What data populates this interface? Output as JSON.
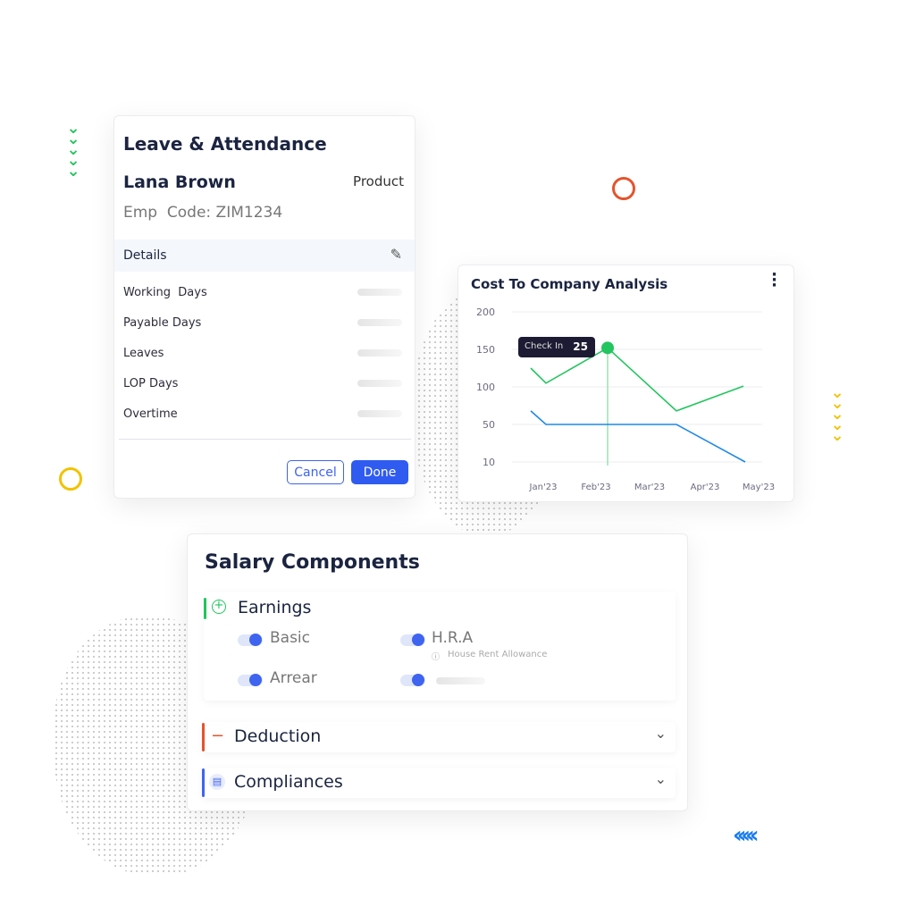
{
  "leave_card": {
    "title": "Leave & Attendance",
    "employee_name": "Lana Brown",
    "department": "Product",
    "emp_code": "Emp  Code: ZIM1234",
    "details_label": "Details",
    "rows": [
      "Working  Days",
      "Payable Days",
      "Leaves",
      "LOP Days",
      "Overtime"
    ],
    "cancel_label": "Cancel",
    "done_label": "Done"
  },
  "chart_card": {
    "title": "Cost To Company Analysis",
    "tooltip_label": "Check In",
    "tooltip_value": "25"
  },
  "chart_data": {
    "type": "line",
    "title": "Cost To Company Analysis",
    "categories": [
      "Jan'23",
      "Feb'23",
      "Mar'23",
      "Apr'23",
      "May'23"
    ],
    "y_ticks": [
      10,
      50,
      100,
      150,
      200
    ],
    "ylim": [
      10,
      200
    ],
    "grid": true,
    "series": [
      {
        "color": "#22c55e",
        "values": [
          125,
          105,
          152,
          68,
          101
        ]
      },
      {
        "color": "#1e88e5",
        "values": [
          68,
          50,
          50,
          10
        ]
      }
    ],
    "highlight": {
      "category": "Feb'23",
      "label": "Check In",
      "value": 25
    }
  },
  "salary_card": {
    "title": "Salary Components",
    "earnings": {
      "label": "Earnings",
      "items": [
        {
          "label": "Basic",
          "on": true
        },
        {
          "label": "H.R.A",
          "hint": "House Rent Allowance",
          "on": true
        },
        {
          "label": "Arrear",
          "on": true
        },
        {
          "label": "",
          "on": true
        }
      ]
    },
    "deduction_label": "Deduction",
    "compliances_label": "Compliances"
  },
  "colors": {
    "accent": "#3e64f0",
    "green": "#22c55e",
    "red": "#e5532d",
    "yellow": "#f2c200",
    "blue": "#1a7cf0",
    "navy": "#1b2440"
  }
}
